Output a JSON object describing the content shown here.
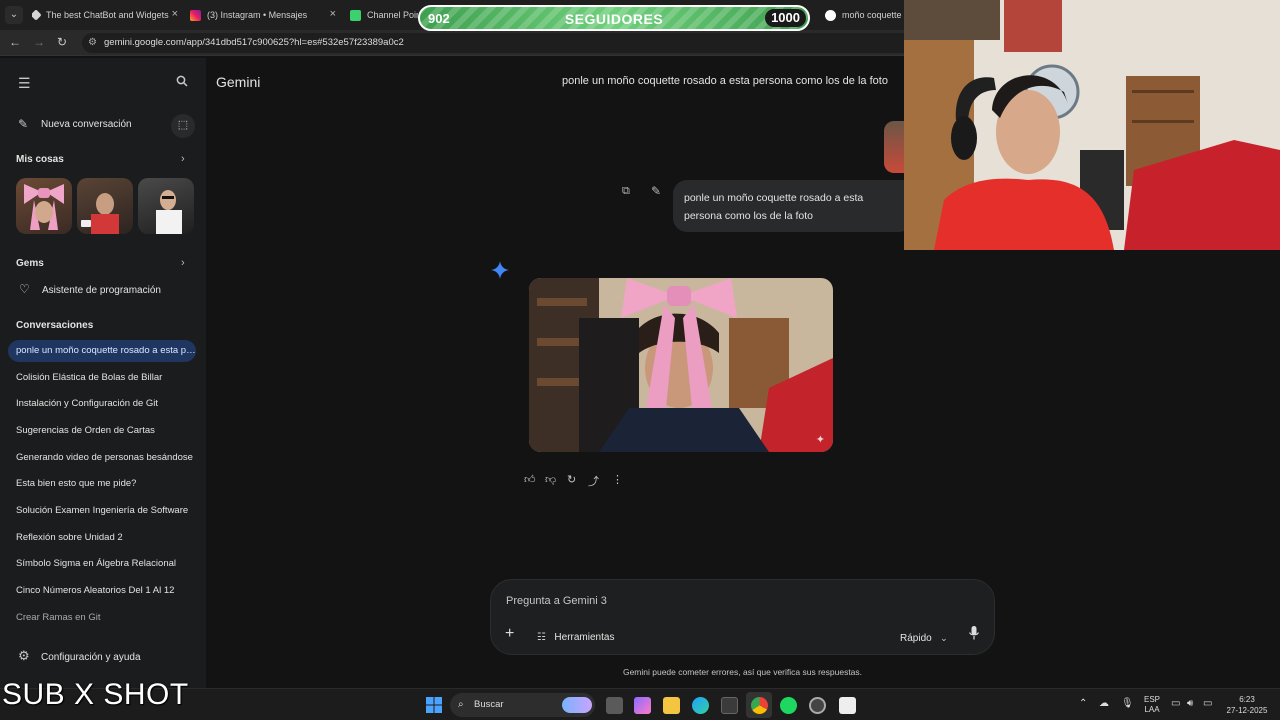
{
  "browser": {
    "tabs": [
      {
        "title": "The best ChatBot and Widgets",
        "close": "×"
      },
      {
        "title": "(3) Instagram • Mensajes",
        "close": "×"
      },
      {
        "title": "Channel Points",
        "close": ""
      },
      {
        "title": "moño coquette -",
        "close": ""
      }
    ],
    "url": "gemini.google.com/app/341dbd517c900625?hl=es#532e57f23389a0c2"
  },
  "followers_widget": {
    "current": "902",
    "label": "SEGUIDORES",
    "goal": "1000"
  },
  "sidebar": {
    "new_chat": "Nueva conversación",
    "my_stuff": "Mis cosas",
    "gems_heading": "Gems",
    "gem_item": "Asistente de programación",
    "conversations_heading": "Conversaciones",
    "conversations": [
      "ponle un moño coquette rosado a esta persona como los de la foto",
      "Colisión Elástica de Bolas de Billar",
      "Instalación y Configuración de Git",
      "Sugerencias de Orden de Cartas",
      "Generando video de personas besándose",
      "Esta bien esto que me pide?",
      "Solución Examen Ingeniería de Software",
      "Reflexión sobre Unidad 2",
      "Símbolo Sigma en Álgebra Relacional",
      "Cinco Números Aleatorios Del 1 Al 12",
      "Crear Ramas en Git"
    ],
    "settings": "Configuración y ayuda"
  },
  "main": {
    "app_name": "Gemini",
    "chat_title": "ponle un moño coquette rosado a esta persona como los de la foto",
    "user_message": "ponle un moño coquette rosado a esta persona como los de la foto",
    "input_placeholder": "Pregunta a Gemini 3",
    "tools": "Herramientas",
    "mode": "Rápido",
    "disclaimer": "Gemini puede cometer errores, así que verifica sus respuestas."
  },
  "overlay_text": "SUB X SHOT",
  "taskbar": {
    "search": "Buscar",
    "lang_top": "ESP",
    "lang_bottom": "LAA",
    "time": "6:23",
    "date": "27-12-2025"
  },
  "colors": {
    "accent": "#1f3760",
    "gemini_star": "#4285f4",
    "follower_green": "#4caf50"
  }
}
